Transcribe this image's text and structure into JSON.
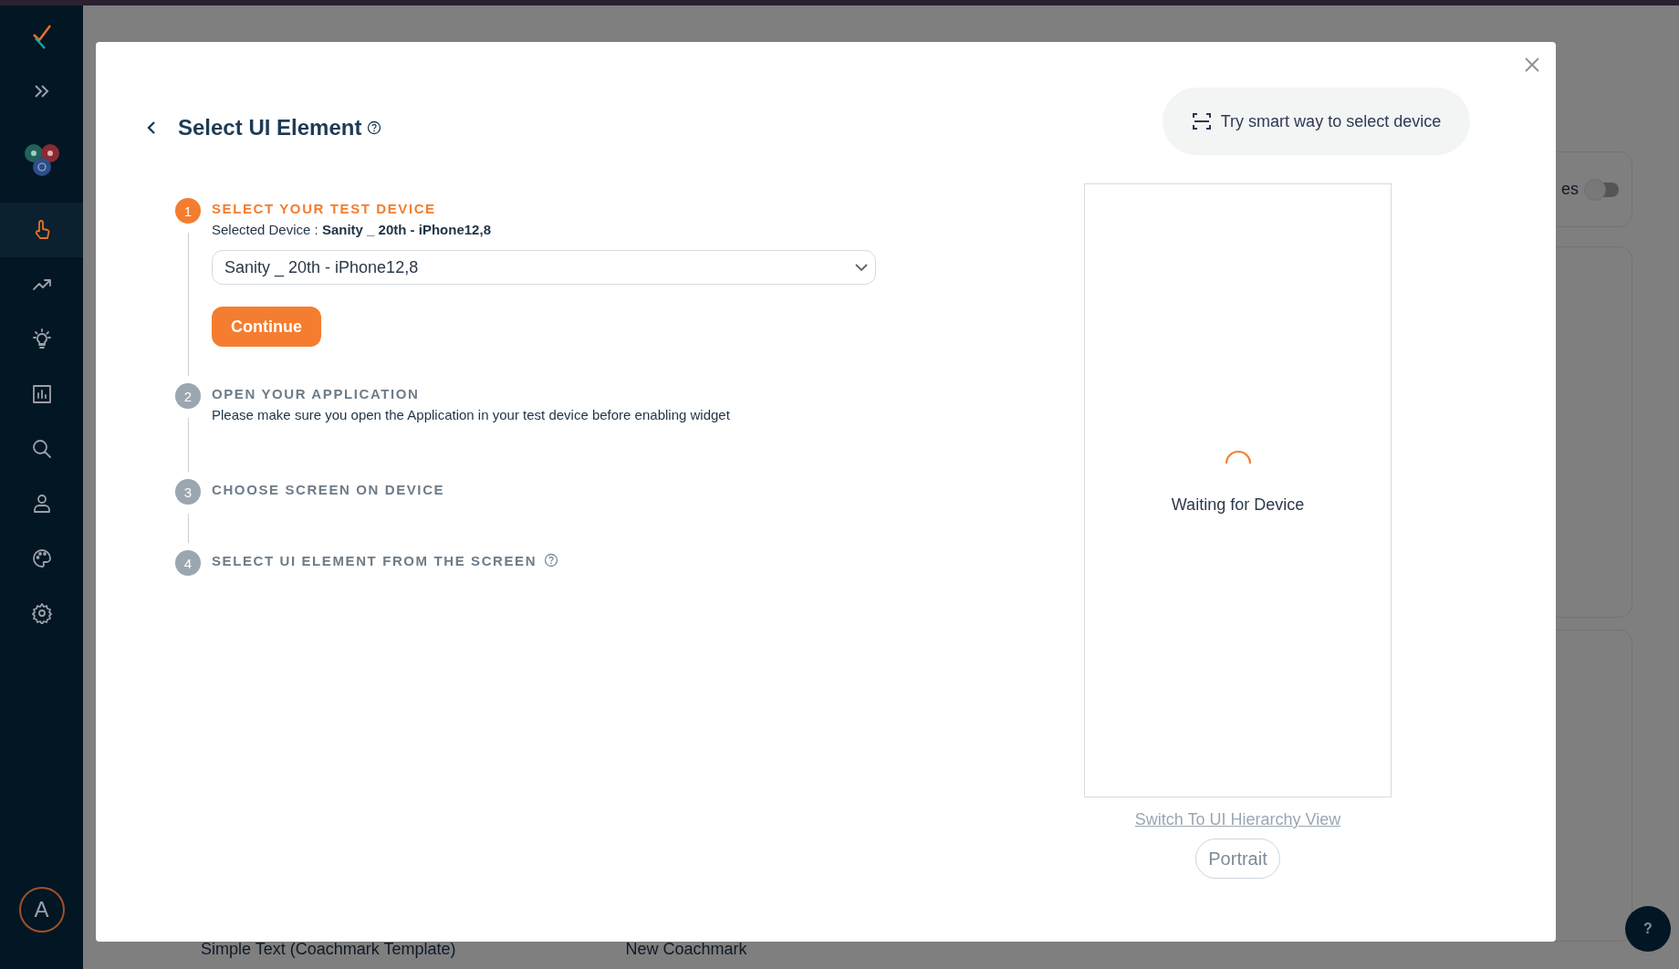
{
  "sidebar": {
    "nav": [
      {
        "selected": true
      },
      {
        "selected": false
      },
      {
        "selected": false
      },
      {
        "selected": false
      },
      {
        "selected": false
      },
      {
        "selected": false
      },
      {
        "selected": false
      },
      {
        "selected": false
      }
    ],
    "avatar": "A"
  },
  "background": {
    "toggle_label": "es",
    "toggle": {
      "on": false
    },
    "row": [
      "Simple Text (Coachmark Template)",
      "New Coachmark"
    ],
    "help_button": "?"
  },
  "modal": {
    "title": "Select UI Element",
    "smart_button": "Try smart way to select device",
    "steps": [
      {
        "number": "1",
        "title": "SELECT YOUR TEST DEVICE",
        "active": true,
        "help": false,
        "kind": "device",
        "detail": "Selected Device : **Sanity _ 20th - iPhone12,8**",
        "dropdown": "Sanity _ 20th - iPhone12,8",
        "button": "Continue"
      },
      {
        "number": "2",
        "title": "OPEN YOUR APPLICATION",
        "active": false,
        "help": false,
        "kind": "text",
        "detail": "Please make sure you open the Application in your test device before enabling widget"
      },
      {
        "number": "3",
        "title": "CHOOSE SCREEN ON DEVICE",
        "active": false,
        "help": false,
        "kind": "plain"
      },
      {
        "number": "4",
        "title": "SELECT UI ELEMENT FROM THE SCREEN",
        "active": false,
        "help": true,
        "kind": "plain"
      }
    ],
    "device": {
      "status": "Waiting for Device",
      "link": "Switch To UI Hierarchy View",
      "orientation": "Portrait"
    }
  }
}
